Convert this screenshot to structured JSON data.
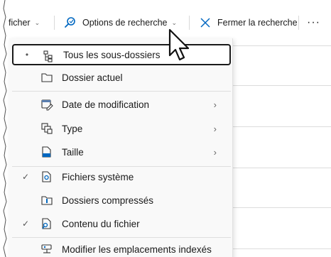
{
  "toolbar": {
    "filter_label": "ficher",
    "filter_chevron": "⌄",
    "options_label": "Options de recherche",
    "options_chevron": "⌄",
    "close_label": "Fermer la recherche",
    "more_label": "···"
  },
  "menu": {
    "items": [
      {
        "label": "Tous les sous-dossiers",
        "mark": "•",
        "icon": "subfolders-icon",
        "arrow": ""
      },
      {
        "label": "Dossier actuel",
        "mark": "",
        "icon": "folder-icon",
        "arrow": ""
      },
      {
        "label": "Date de modification",
        "mark": "",
        "icon": "calendar-edit-icon",
        "arrow": "›"
      },
      {
        "label": "Type",
        "mark": "",
        "icon": "type-icon",
        "arrow": "›"
      },
      {
        "label": "Taille",
        "mark": "",
        "icon": "size-icon",
        "arrow": "›"
      },
      {
        "label": "Fichiers système",
        "mark": "✓",
        "icon": "system-file-icon",
        "arrow": ""
      },
      {
        "label": "Dossiers compressés",
        "mark": "",
        "icon": "zip-folder-icon",
        "arrow": ""
      },
      {
        "label": "Contenu du fichier",
        "mark": "✓",
        "icon": "file-content-icon",
        "arrow": ""
      },
      {
        "label": "Modifier les emplacements indexés",
        "mark": "",
        "icon": "index-locations-icon",
        "arrow": ""
      }
    ]
  },
  "colors": {
    "accent": "#0067c0",
    "text": "#1a1a1a",
    "menu_bg": "#f9f9f9",
    "selected_border": "#1a1a1a"
  }
}
